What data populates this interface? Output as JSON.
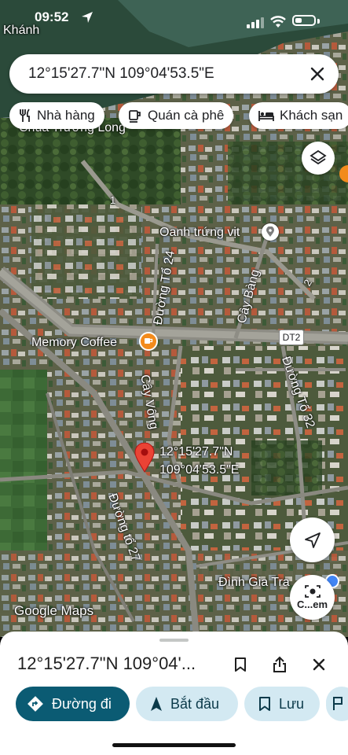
{
  "status": {
    "time": "09:52"
  },
  "search": {
    "query": "12°15'27.7\"N 109°04'53.5\"E"
  },
  "chips": [
    {
      "label": "Nhà hàng",
      "icon": "fork-knife-icon"
    },
    {
      "label": "Quán cà phê",
      "icon": "coffee-cup-icon"
    },
    {
      "label": "Khách sạn",
      "icon": "bed-icon"
    }
  ],
  "map": {
    "labels": {
      "top_city": "Khánh",
      "chua": "Chùa Trường Long",
      "oanh": "Oanh trứng vịt",
      "cay_bang": "Cây Bàng",
      "duong_to_24": "Đường Tổ 24",
      "memory": "Memory Coffee",
      "dt2": "DT2",
      "cay_vong": "Cây Vông",
      "duong_to_32": "Đường Tổ 32",
      "pin_lat": "12°15'27.7\"N",
      "pin_lng": "109°04'53.5\"E",
      "duong_to_27": "Đường tổ 27",
      "dinh": "Đình Gia Tra",
      "road_1": "1",
      "road_2": "2",
      "watermark": "Google Maps",
      "lens": "C...em"
    }
  },
  "sheet": {
    "title": "12°15'27.7\"N 109°04'...",
    "actions": [
      {
        "label": "Đường đi",
        "icon": "directions-icon"
      },
      {
        "label": "Bắt đầu",
        "icon": "navigation-arrow-icon"
      },
      {
        "label": "Lưu",
        "icon": "bookmark-icon"
      }
    ]
  },
  "colors": {
    "accent": "#0b57d0",
    "primary_button": "#0b5b73",
    "tonal_button": "#d3e9f2",
    "pin": "#ea4335"
  }
}
